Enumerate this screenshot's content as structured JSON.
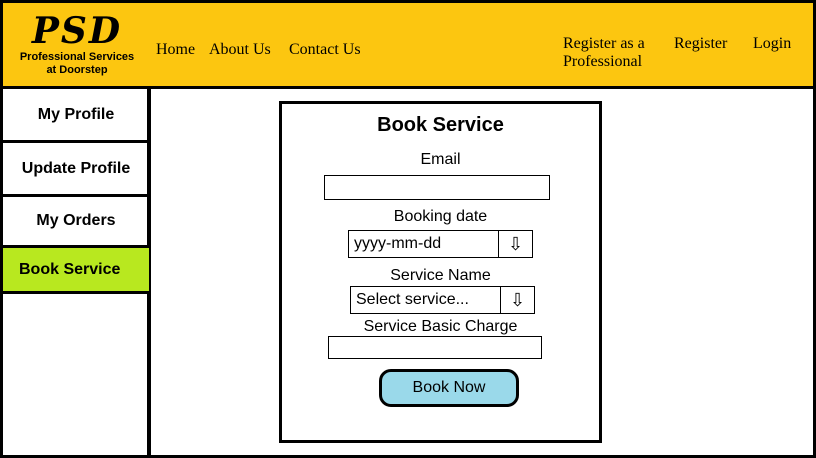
{
  "header": {
    "logo": "PSD",
    "tagline_line1": "Professional Services",
    "tagline_line2": "at Doorstep",
    "nav": {
      "home": "Home",
      "about": "About Us",
      "contact": "Contact Us",
      "register_pro_line1": "Register as a",
      "register_pro_line2": "Professional",
      "register": "Register",
      "login": "Login"
    }
  },
  "sidebar": {
    "items": [
      {
        "label": "My Profile"
      },
      {
        "label": "Update Profile"
      },
      {
        "label": "My Orders"
      },
      {
        "label": "Book Service",
        "active": true
      }
    ]
  },
  "form": {
    "title": "Book Service",
    "email_label": "Email",
    "email_value": "",
    "date_label": "Booking date",
    "date_value": "yyyy-mm-dd",
    "service_label": "Service Name",
    "service_value": "Select service...",
    "charge_label": "Service Basic Charge",
    "charge_value": "",
    "submit_label": "Book Now",
    "dropdown_icon": "⇩"
  },
  "colors": {
    "header_bg": "#fcc610",
    "active_item": "#b8e81f",
    "button_bg": "#9ad9ea"
  }
}
